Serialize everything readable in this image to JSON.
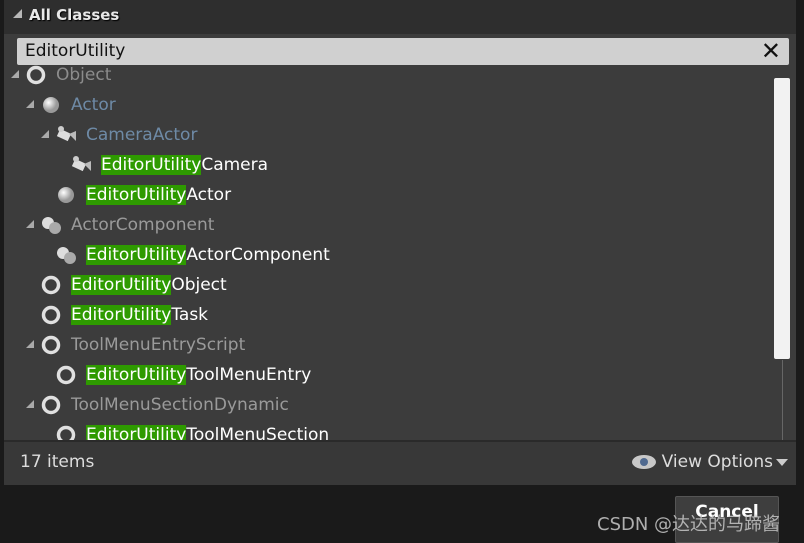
{
  "header": {
    "title": "All Classes"
  },
  "search": {
    "value": "EditorUtility",
    "clear_icon": "close-icon"
  },
  "tree": [
    {
      "level": 0,
      "expanded": true,
      "icon": "object-icon",
      "match": "",
      "rest": "Object",
      "color": "#8c8c8c"
    },
    {
      "level": 1,
      "expanded": true,
      "icon": "sphere-icon",
      "match": "",
      "rest": "Actor",
      "color": "#6e8aa6"
    },
    {
      "level": 2,
      "expanded": true,
      "icon": "camera-icon",
      "match": "",
      "rest": "CameraActor",
      "color": "#6e8aa6"
    },
    {
      "level": 3,
      "expanded": false,
      "icon": "camera-icon",
      "match": "EditorUtility",
      "rest": "Camera",
      "color": "#ffffff"
    },
    {
      "level": 2,
      "expanded": false,
      "icon": "sphere-icon",
      "match": "EditorUtility",
      "rest": "Actor",
      "color": "#ffffff"
    },
    {
      "level": 1,
      "expanded": true,
      "icon": "component-icon",
      "match": "",
      "rest": "ActorComponent",
      "color": "#9a9a9a"
    },
    {
      "level": 2,
      "expanded": false,
      "icon": "component-icon",
      "match": "EditorUtility",
      "rest": "ActorComponent",
      "color": "#ffffff"
    },
    {
      "level": 1,
      "expanded": false,
      "icon": "object-icon",
      "match": "EditorUtility",
      "rest": "Object",
      "color": "#ffffff"
    },
    {
      "level": 1,
      "expanded": false,
      "icon": "object-icon",
      "match": "EditorUtility",
      "rest": "Task",
      "color": "#ffffff"
    },
    {
      "level": 1,
      "expanded": true,
      "icon": "object-icon",
      "match": "",
      "rest": "ToolMenuEntryScript",
      "color": "#9a9a9a"
    },
    {
      "level": 2,
      "expanded": false,
      "icon": "object-icon",
      "match": "EditorUtility",
      "rest": "ToolMenuEntry",
      "color": "#ffffff"
    },
    {
      "level": 1,
      "expanded": true,
      "icon": "object-icon",
      "match": "",
      "rest": "ToolMenuSectionDynamic",
      "color": "#9a9a9a"
    },
    {
      "level": 2,
      "expanded": false,
      "icon": "object-icon",
      "match": "EditorUtility",
      "rest": "ToolMenuSection",
      "color": "#ffffff"
    }
  ],
  "footer": {
    "count": "17 items",
    "view_options": "View Options"
  },
  "cancel_label": "Cancel",
  "watermark": "CSDN @达达的马蹄酱",
  "colors": {
    "highlight": "#2e9a00"
  }
}
